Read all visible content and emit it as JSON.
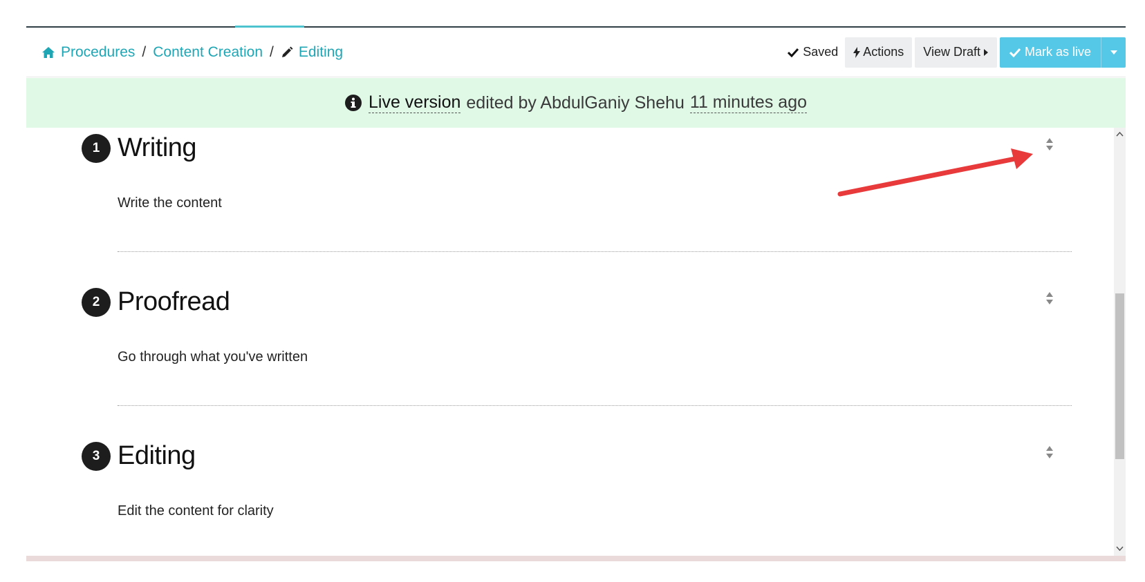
{
  "breadcrumb": {
    "items": [
      {
        "label": "Procedures",
        "icon": "home-icon"
      },
      {
        "label": "Content Creation"
      },
      {
        "label": "Editing",
        "icon": "pencil-icon"
      }
    ],
    "separator": "/"
  },
  "toolbar": {
    "saved_label": "Saved",
    "actions_label": "Actions",
    "view_draft_label": "View Draft",
    "mark_live_label": "Mark as live"
  },
  "notice": {
    "live_label": "Live version",
    "edited_by_text": "edited by AbdulGaniy Shehu",
    "time_ago": "11 minutes ago"
  },
  "steps": [
    {
      "number": "1",
      "title": "Writing",
      "description": "Write the content"
    },
    {
      "number": "2",
      "title": "Proofread",
      "description": "Go through what you've written"
    },
    {
      "number": "3",
      "title": "Editing",
      "description": "Edit the content for clarity"
    }
  ],
  "colors": {
    "accent": "#1fa6b5",
    "primary_button": "#55c8e8",
    "notice_bg": "#e0f9e7",
    "annotation_arrow": "#e8393b"
  }
}
